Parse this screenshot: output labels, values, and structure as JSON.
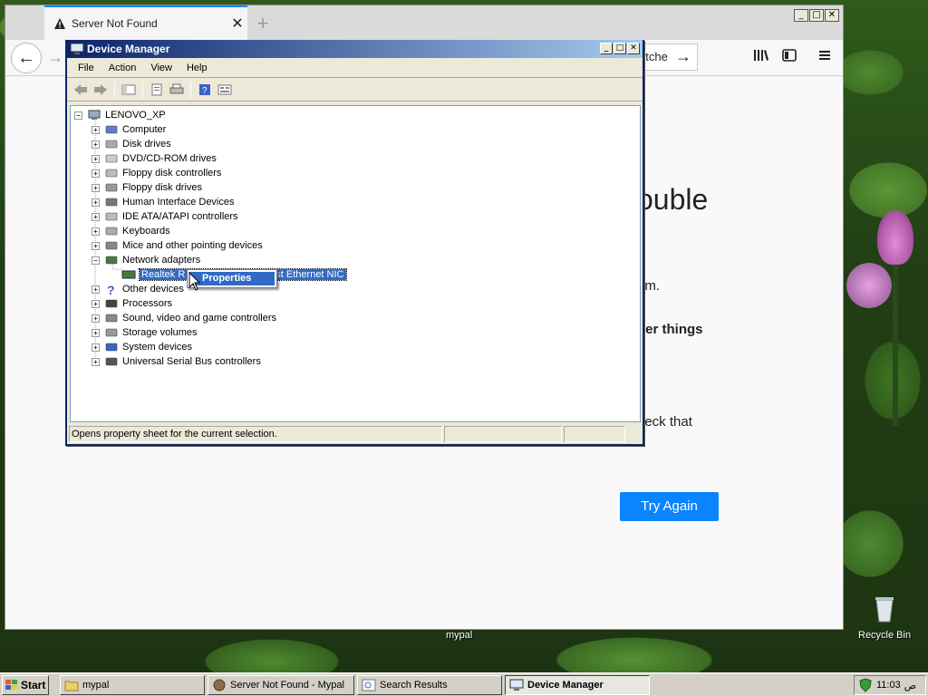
{
  "browser": {
    "tab_title": "Server Not Found",
    "new_tab": "+",
    "search_fragment": "atche",
    "page_title_fragment": "ouble",
    "text1_fragment": "om.",
    "text2_fragment": "her things",
    "text3_fragment": "neck that",
    "try_again": "Try Again"
  },
  "device_manager": {
    "title": "Device Manager",
    "menu": [
      "File",
      "Action",
      "View",
      "Help"
    ],
    "tree_root": "LENOVO_XP",
    "tree_items": [
      {
        "label": "Computer",
        "icon": "computer-icon"
      },
      {
        "label": "Disk drives",
        "icon": "disk-drive-icon"
      },
      {
        "label": "DVD/CD-ROM drives",
        "icon": "cdrom-icon"
      },
      {
        "label": "Floppy disk controllers",
        "icon": "floppy-controller-icon"
      },
      {
        "label": "Floppy disk drives",
        "icon": "floppy-drive-icon"
      },
      {
        "label": "Human Interface Devices",
        "icon": "hid-icon"
      },
      {
        "label": "IDE ATA/ATAPI controllers",
        "icon": "ide-controller-icon"
      },
      {
        "label": "Keyboards",
        "icon": "keyboard-icon"
      },
      {
        "label": "Mice and other pointing devices",
        "icon": "mouse-icon"
      },
      {
        "label": "Network adapters",
        "icon": "network-adapter-icon"
      },
      {
        "label": "Other devices",
        "icon": "unknown-device-icon"
      },
      {
        "label": "Processors",
        "icon": "processor-icon"
      },
      {
        "label": "Sound, video and game controllers",
        "icon": "sound-icon"
      },
      {
        "label": "Storage volumes",
        "icon": "storage-volume-icon"
      },
      {
        "label": "System devices",
        "icon": "system-devices-icon"
      },
      {
        "label": "Universal Serial Bus controllers",
        "icon": "usb-icon"
      }
    ],
    "selected_child_left": "Realtek R",
    "selected_child_right": "st Ethernet NIC",
    "context_menu_item": "Properties",
    "status_text": "Opens property sheet for the current selection."
  },
  "desktop": {
    "folder_label": "mypal",
    "recycle_bin": "Recycle Bin"
  },
  "taskbar": {
    "start": "Start",
    "items": [
      "mypal",
      "Server Not Found - Mypal",
      "Search Results",
      "Device Manager"
    ],
    "clock": "11:03",
    "ampm": "ص"
  },
  "colors": {
    "accent": "#0a84ff",
    "xp_title": "#0a246a",
    "selection": "#316ac5"
  }
}
